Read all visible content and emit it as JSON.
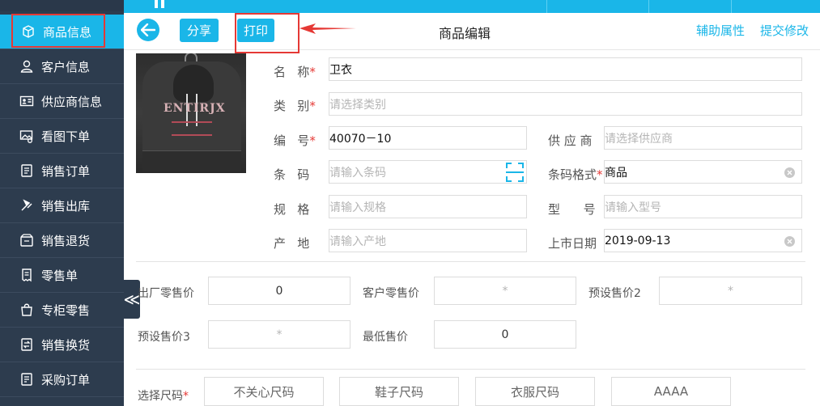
{
  "sidebar": {
    "items": [
      {
        "label": "商品信息",
        "icon": "box-icon"
      },
      {
        "label": "客户信息",
        "icon": "person-icon"
      },
      {
        "label": "供应商信息",
        "icon": "id-card-icon"
      },
      {
        "label": "看图下单",
        "icon": "image-cart-icon"
      },
      {
        "label": "销售订单",
        "icon": "order-icon"
      },
      {
        "label": "销售出库",
        "icon": "outbound-icon"
      },
      {
        "label": "销售退货",
        "icon": "return-icon"
      },
      {
        "label": "零售单",
        "icon": "receipt-icon"
      },
      {
        "label": "专柜零售",
        "icon": "bag-icon"
      },
      {
        "label": "销售换货",
        "icon": "exchange-icon"
      },
      {
        "label": "采购订单",
        "icon": "purchase-icon"
      }
    ],
    "collapse_glyph": "≪"
  },
  "toolbar": {
    "share_label": "分享",
    "print_label": "打印",
    "title": "商品编辑",
    "aux_label": "辅助属性",
    "submit_label": "提交修改"
  },
  "form": {
    "name": {
      "label": "名   称",
      "required": "*",
      "value": "卫衣"
    },
    "category": {
      "label": "类   别",
      "required": "*",
      "placeholder": "请选择类别"
    },
    "code": {
      "label": "编   号",
      "required": "*",
      "value": "40070－10"
    },
    "supplier": {
      "label": "供 应 商",
      "placeholder": "请选择供应商"
    },
    "barcode": {
      "label": "条   码",
      "placeholder": "请输入条码"
    },
    "barcode_format": {
      "label": "条码格式",
      "required": "*",
      "value": "商品"
    },
    "spec": {
      "label": "规   格",
      "placeholder": "请输入规格"
    },
    "model": {
      "label": "型      号",
      "placeholder": "请输入型号"
    },
    "origin": {
      "label": "产   地",
      "placeholder": "请输入产地"
    },
    "launch_date": {
      "label": "上市日期",
      "value": "2019-09-13"
    }
  },
  "prices": {
    "factory_retail": {
      "label": "出厂零售价",
      "value": "0"
    },
    "customer_retail": {
      "label": "客户零售价",
      "value": "*"
    },
    "preset2": {
      "label": "预设售价2",
      "value": "*"
    },
    "preset3": {
      "label": "预设售价3",
      "value": "*"
    },
    "min_price": {
      "label": "最低售价",
      "value": "0"
    }
  },
  "sizes": {
    "label": "选择尺码",
    "required": "*",
    "options": [
      "不关心尺码",
      "鞋子尺码",
      "衣服尺码",
      "AAAA"
    ]
  },
  "product_image": {
    "print_text": "ENTIRJX"
  },
  "colors": {
    "accent": "#1ab6e8",
    "sidebar": "#2d3c4e",
    "highlight": "#e53935"
  }
}
